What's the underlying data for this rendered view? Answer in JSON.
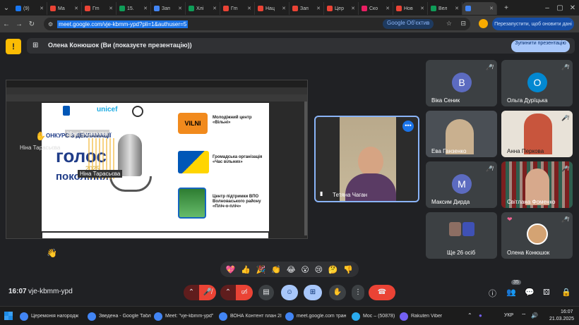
{
  "browser": {
    "tabs": [
      {
        "label": "(9)",
        "color": "#1877f2"
      },
      {
        "label": "Ма",
        "color": "#ea4335"
      },
      {
        "label": "Гm",
        "color": "#ea4335"
      },
      {
        "label": "15.",
        "color": "#0f9d58"
      },
      {
        "label": "Зап",
        "color": "#4285f4"
      },
      {
        "label": "Хлі",
        "color": "#0f9d58"
      },
      {
        "label": "Гm",
        "color": "#ea4335"
      },
      {
        "label": "Нац",
        "color": "#ea4335"
      },
      {
        "label": "Зап",
        "color": "#ea4335"
      },
      {
        "label": "Цер",
        "color": "#ea4335"
      },
      {
        "label": "Ско",
        "color": "#e91e63"
      },
      {
        "label": "Нов",
        "color": "#ea4335"
      },
      {
        "label": "Вел",
        "color": "#0f9d58"
      },
      {
        "label": "",
        "color": "#4285f4",
        "active": true
      }
    ],
    "url": "meet.google.com/vje-kbmm-ypd?pli=1&authuser=5",
    "lens_label": "Google Об'єктив",
    "restart_label": "Перезапустити, щоб оновити дані"
  },
  "presenter": {
    "text": "Олена Конюшок (Ви (показуєте презентацію))",
    "stop_label": "Зупинити презентацію"
  },
  "share": {
    "overlay_names": [
      "Ніна Тарасьєва",
      "Ніна Тарасьєва",
      "Ніна Тарасьєва"
    ],
    "slide": {
      "title_part": "ОНКУРС З ДЕКЛАМАЦІЇ",
      "big1": "голос",
      "big2": "покоління",
      "year": "2025",
      "logo_text": "unicef",
      "orgs": [
        {
          "name": "Молодіжний центр «Вільні»",
          "logo": "VILNI"
        },
        {
          "name": "Громадська організація «Час вільних»",
          "logo": ""
        },
        {
          "name": "Центр підтримки ВПО Волноваського району «Пліч-о-пліч»",
          "logo": ""
        }
      ]
    }
  },
  "tiles": [
    {
      "name": "Віка Сеник",
      "initial": "В",
      "color": "#5c6bc0"
    },
    {
      "name": "Ольга Дурїцька",
      "initial": "О",
      "color": "#0288d1"
    },
    {
      "name": "Ева Ганзенко",
      "initial": "",
      "color": ""
    },
    {
      "name": "Анна Перкова",
      "initial": "",
      "color": ""
    },
    {
      "name": "Максим Дирда",
      "initial": "М",
      "color": "#5c6bc0"
    },
    {
      "name": "Світлана Фоменко",
      "initial": "",
      "color": ""
    },
    {
      "name": "Ще 26 осіб",
      "initial": "",
      "color": ""
    },
    {
      "name": "Олена Конюшок",
      "initial": "",
      "color": ""
    }
  ],
  "active_speaker": {
    "name": "Тетяна Чаган"
  },
  "emojis": [
    "💖",
    "👍",
    "🎉",
    "👏",
    "😂",
    "😮",
    "😢",
    "🤔",
    "👎"
  ],
  "controls": {
    "meeting_time": "16:07",
    "meeting_code": "vje-kbmm-ypd",
    "participants_count": "35"
  },
  "taskbar": {
    "items": [
      {
        "label": "Церемонія нагородж",
        "color": "#4285f4"
      },
      {
        "label": "Зведена - Google Табл",
        "color": "#4285f4"
      },
      {
        "label": "Meet: \"vje-kbmm-ypd\"",
        "color": "#4285f4"
      },
      {
        "label": "ВОНА Контент план 2І",
        "color": "#4285f4"
      },
      {
        "label": "meet.google.com тран",
        "color": "#4285f4"
      },
      {
        "label": "Мос – (50878)",
        "color": "#2aabee"
      },
      {
        "label": "Rakuten Viber",
        "color": "#7360f2"
      }
    ],
    "lang": "УКР",
    "time": "16:07",
    "date": "21.03.2025"
  }
}
